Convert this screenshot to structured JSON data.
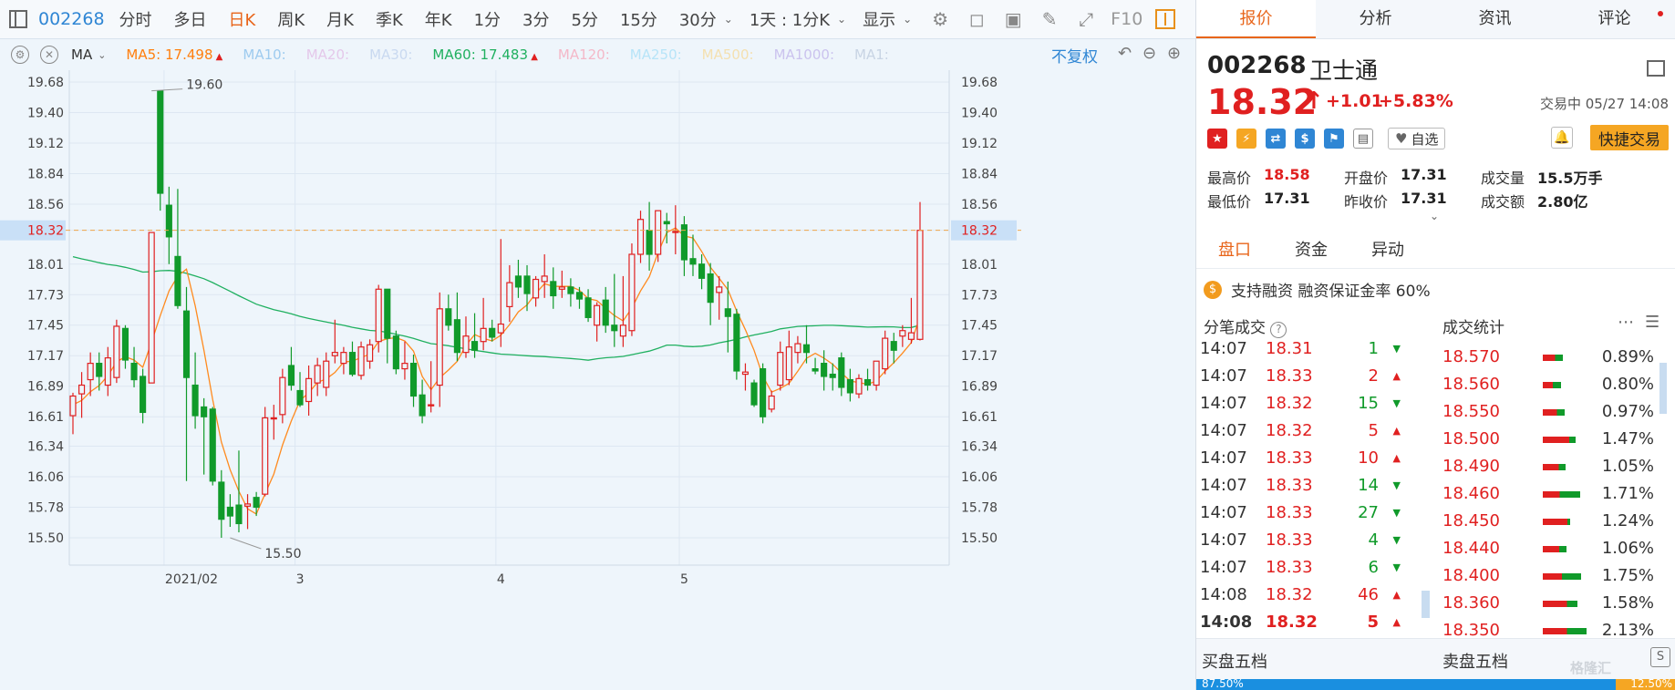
{
  "toolbar": {
    "code": "002268",
    "periods": [
      "分时",
      "多日",
      "日K",
      "周K",
      "月K",
      "季K",
      "年K",
      "1分",
      "3分",
      "5分",
      "15分",
      "30分"
    ],
    "active_period": "日K",
    "range": "1天 : 1分K",
    "display": "显示",
    "f10": "F10"
  },
  "ma_bar": {
    "indicator": "MA",
    "items": [
      {
        "label": "MA5:",
        "value": "17.498",
        "color": "#ff7f0e",
        "up": true
      },
      {
        "label": "MA10:",
        "value": "",
        "color": "#9ecbef",
        "up": false
      },
      {
        "label": "MA20:",
        "value": "",
        "color": "#e4c8ea",
        "up": false
      },
      {
        "label": "MA30:",
        "value": "",
        "color": "#c9d9f0",
        "up": false
      },
      {
        "label": "MA60:",
        "value": "17.483",
        "color": "#20b060",
        "up": true
      },
      {
        "label": "MA120:",
        "value": "",
        "color": "#f4b8c8",
        "up": false
      },
      {
        "label": "MA250:",
        "value": "",
        "color": "#b7e4f8",
        "up": false
      },
      {
        "label": "MA500:",
        "value": "",
        "color": "#f4e0b0",
        "up": false
      },
      {
        "label": "MA1000:",
        "value": "",
        "color": "#cbc3ee",
        "up": false
      },
      {
        "label": "MA1:",
        "value": "",
        "color": "#c8d4e4",
        "up": false
      }
    ],
    "fuquan": "不复权"
  },
  "chart_data": {
    "type": "candlestick",
    "y_ticks": [
      19.68,
      19.4,
      19.12,
      18.84,
      18.56,
      18.32,
      18.01,
      17.73,
      17.45,
      17.17,
      16.89,
      16.61,
      16.34,
      16.06,
      15.78,
      15.5
    ],
    "ylim": [
      15.5,
      19.68
    ],
    "current_price": 18.32,
    "x_labels": [
      {
        "label": "2021/02",
        "index": 12
      },
      {
        "label": "3",
        "index": 27
      },
      {
        "label": "4",
        "index": 50
      },
      {
        "label": "5",
        "index": 71
      }
    ],
    "annotations": [
      {
        "label": "19.60",
        "index": 9,
        "value": 19.6
      },
      {
        "label": "15.50",
        "index": 18,
        "value": 15.5
      }
    ],
    "marker_indices": [
      4,
      10,
      17,
      23,
      24,
      52,
      53,
      57,
      63,
      72
    ],
    "candles": [
      {
        "o": 16.62,
        "h": 16.83,
        "l": 16.45,
        "c": 16.8
      },
      {
        "o": 16.82,
        "h": 17.02,
        "l": 16.6,
        "c": 16.9
      },
      {
        "o": 16.95,
        "h": 17.2,
        "l": 16.8,
        "c": 17.1
      },
      {
        "o": 17.1,
        "h": 17.2,
        "l": 16.85,
        "c": 16.98
      },
      {
        "o": 16.9,
        "h": 17.25,
        "l": 16.8,
        "c": 17.15
      },
      {
        "o": 16.97,
        "h": 17.5,
        "l": 16.92,
        "c": 17.44
      },
      {
        "o": 17.42,
        "h": 17.45,
        "l": 17.05,
        "c": 17.13
      },
      {
        "o": 17.1,
        "h": 17.25,
        "l": 16.88,
        "c": 16.95
      },
      {
        "o": 16.98,
        "h": 17.05,
        "l": 16.55,
        "c": 16.65
      },
      {
        "o": 16.92,
        "h": 18.3,
        "l": 16.92,
        "c": 18.3
      },
      {
        "o": 19.6,
        "h": 19.6,
        "l": 18.5,
        "c": 18.66
      },
      {
        "o": 18.55,
        "h": 18.72,
        "l": 18.01,
        "c": 18.26
      },
      {
        "o": 18.08,
        "h": 18.7,
        "l": 17.6,
        "c": 17.63
      },
      {
        "o": 17.58,
        "h": 17.8,
        "l": 16.02,
        "c": 16.97
      },
      {
        "o": 16.9,
        "h": 17.2,
        "l": 16.5,
        "c": 16.62
      },
      {
        "o": 16.7,
        "h": 16.78,
        "l": 16.08,
        "c": 16.61
      },
      {
        "o": 16.68,
        "h": 16.7,
        "l": 15.98,
        "c": 16.02
      },
      {
        "o": 16.01,
        "h": 16.12,
        "l": 15.5,
        "c": 15.67
      },
      {
        "o": 15.78,
        "h": 15.9,
        "l": 15.6,
        "c": 15.7
      },
      {
        "o": 15.8,
        "h": 16.3,
        "l": 15.55,
        "c": 15.63
      },
      {
        "o": 15.79,
        "h": 15.9,
        "l": 15.58,
        "c": 15.81
      },
      {
        "o": 15.87,
        "h": 15.92,
        "l": 15.7,
        "c": 15.78
      },
      {
        "o": 15.9,
        "h": 16.7,
        "l": 15.88,
        "c": 16.6
      },
      {
        "o": 16.6,
        "h": 16.72,
        "l": 16.4,
        "c": 16.6
      },
      {
        "o": 16.63,
        "h": 17.05,
        "l": 16.55,
        "c": 16.97
      },
      {
        "o": 17.08,
        "h": 17.25,
        "l": 16.85,
        "c": 16.9
      },
      {
        "o": 16.85,
        "h": 17.02,
        "l": 16.7,
        "c": 16.72
      },
      {
        "o": 16.75,
        "h": 17.08,
        "l": 16.62,
        "c": 16.96
      },
      {
        "o": 16.92,
        "h": 17.15,
        "l": 16.8,
        "c": 17.08
      },
      {
        "o": 16.88,
        "h": 17.2,
        "l": 16.8,
        "c": 17.12
      },
      {
        "o": 17.17,
        "h": 17.5,
        "l": 17.1,
        "c": 17.2
      },
      {
        "o": 17.1,
        "h": 17.25,
        "l": 17.0,
        "c": 17.2
      },
      {
        "o": 17.2,
        "h": 17.3,
        "l": 16.98,
        "c": 17.0
      },
      {
        "o": 16.99,
        "h": 17.3,
        "l": 16.95,
        "c": 17.25
      },
      {
        "o": 17.12,
        "h": 17.32,
        "l": 17.05,
        "c": 17.27
      },
      {
        "o": 17.3,
        "h": 17.82,
        "l": 17.2,
        "c": 17.78
      },
      {
        "o": 17.78,
        "h": 17.78,
        "l": 17.1,
        "c": 17.33
      },
      {
        "o": 17.35,
        "h": 17.4,
        "l": 17.0,
        "c": 17.05
      },
      {
        "o": 17.05,
        "h": 17.3,
        "l": 16.95,
        "c": 17.1
      },
      {
        "o": 17.1,
        "h": 17.18,
        "l": 16.7,
        "c": 16.8
      },
      {
        "o": 16.81,
        "h": 16.95,
        "l": 16.55,
        "c": 16.62
      },
      {
        "o": 16.72,
        "h": 17.12,
        "l": 16.65,
        "c": 16.72
      },
      {
        "o": 16.9,
        "h": 17.75,
        "l": 16.7,
        "c": 17.6
      },
      {
        "o": 17.6,
        "h": 17.73,
        "l": 17.4,
        "c": 17.45
      },
      {
        "o": 17.5,
        "h": 17.75,
        "l": 17.12,
        "c": 17.2
      },
      {
        "o": 17.2,
        "h": 17.53,
        "l": 17.15,
        "c": 17.35
      },
      {
        "o": 17.3,
        "h": 17.56,
        "l": 17.15,
        "c": 17.22
      },
      {
        "o": 17.3,
        "h": 17.7,
        "l": 17.22,
        "c": 17.42
      },
      {
        "o": 17.42,
        "h": 17.5,
        "l": 17.3,
        "c": 17.34
      },
      {
        "o": 17.38,
        "h": 18.24,
        "l": 17.25,
        "c": 17.46
      },
      {
        "o": 17.62,
        "h": 18.0,
        "l": 17.48,
        "c": 17.84
      },
      {
        "o": 17.9,
        "h": 18.05,
        "l": 17.7,
        "c": 17.8
      },
      {
        "o": 17.9,
        "h": 18.0,
        "l": 17.58,
        "c": 17.74
      },
      {
        "o": 17.7,
        "h": 17.9,
        "l": 17.62,
        "c": 17.87
      },
      {
        "o": 17.85,
        "h": 18.1,
        "l": 17.7,
        "c": 17.9
      },
      {
        "o": 17.85,
        "h": 17.98,
        "l": 17.6,
        "c": 17.72
      },
      {
        "o": 17.78,
        "h": 17.95,
        "l": 17.7,
        "c": 17.8
      },
      {
        "o": 17.8,
        "h": 17.88,
        "l": 17.62,
        "c": 17.74
      },
      {
        "o": 17.75,
        "h": 17.8,
        "l": 17.6,
        "c": 17.69
      },
      {
        "o": 17.7,
        "h": 17.78,
        "l": 17.48,
        "c": 17.52
      },
      {
        "o": 17.45,
        "h": 17.66,
        "l": 17.3,
        "c": 17.63
      },
      {
        "o": 17.68,
        "h": 17.8,
        "l": 17.38,
        "c": 17.45
      },
      {
        "o": 17.45,
        "h": 17.92,
        "l": 17.25,
        "c": 17.4
      },
      {
        "o": 17.35,
        "h": 17.9,
        "l": 17.25,
        "c": 17.45
      },
      {
        "o": 17.4,
        "h": 18.2,
        "l": 17.35,
        "c": 18.1
      },
      {
        "o": 18.1,
        "h": 18.5,
        "l": 18.02,
        "c": 18.42
      },
      {
        "o": 18.32,
        "h": 18.58,
        "l": 17.95,
        "c": 18.1
      },
      {
        "o": 18.1,
        "h": 18.5,
        "l": 18.03,
        "c": 18.5
      },
      {
        "o": 18.4,
        "h": 18.48,
        "l": 18.2,
        "c": 18.38
      },
      {
        "o": 18.3,
        "h": 18.55,
        "l": 18.1,
        "c": 18.31
      },
      {
        "o": 18.37,
        "h": 18.45,
        "l": 17.9,
        "c": 18.05
      },
      {
        "o": 18.06,
        "h": 18.28,
        "l": 17.9,
        "c": 18.01
      },
      {
        "o": 18.01,
        "h": 18.1,
        "l": 17.78,
        "c": 17.88
      },
      {
        "o": 17.92,
        "h": 18.02,
        "l": 17.45,
        "c": 17.66
      },
      {
        "o": 17.75,
        "h": 17.9,
        "l": 17.5,
        "c": 17.8
      },
      {
        "o": 17.6,
        "h": 17.85,
        "l": 17.2,
        "c": 17.53
      },
      {
        "o": 17.55,
        "h": 17.6,
        "l": 16.95,
        "c": 17.03
      },
      {
        "o": 17.0,
        "h": 17.1,
        "l": 16.85,
        "c": 17.02
      },
      {
        "o": 16.92,
        "h": 16.95,
        "l": 16.7,
        "c": 16.72
      },
      {
        "o": 17.05,
        "h": 17.1,
        "l": 16.55,
        "c": 16.61
      },
      {
        "o": 16.68,
        "h": 16.85,
        "l": 16.65,
        "c": 16.8
      },
      {
        "o": 16.9,
        "h": 17.3,
        "l": 16.85,
        "c": 17.2
      },
      {
        "o": 16.95,
        "h": 17.4,
        "l": 16.9,
        "c": 17.25
      },
      {
        "o": 17.2,
        "h": 17.35,
        "l": 17.1,
        "c": 17.28
      },
      {
        "o": 17.27,
        "h": 17.45,
        "l": 17.1,
        "c": 17.2
      },
      {
        "o": 17.05,
        "h": 17.15,
        "l": 17.0,
        "c": 17.03
      },
      {
        "o": 17.1,
        "h": 17.22,
        "l": 16.85,
        "c": 16.98
      },
      {
        "o": 17.0,
        "h": 17.1,
        "l": 16.85,
        "c": 16.97
      },
      {
        "o": 17.15,
        "h": 17.2,
        "l": 16.8,
        "c": 16.88
      },
      {
        "o": 16.95,
        "h": 17.05,
        "l": 16.75,
        "c": 16.83
      },
      {
        "o": 16.82,
        "h": 17.0,
        "l": 16.78,
        "c": 16.96
      },
      {
        "o": 16.95,
        "h": 17.05,
        "l": 16.85,
        "c": 16.9
      },
      {
        "o": 16.9,
        "h": 17.1,
        "l": 16.85,
        "c": 17.12
      },
      {
        "o": 17.05,
        "h": 17.4,
        "l": 17.0,
        "c": 17.33
      },
      {
        "o": 17.3,
        "h": 17.38,
        "l": 17.1,
        "c": 17.22
      },
      {
        "o": 17.35,
        "h": 17.45,
        "l": 17.25,
        "c": 17.4
      },
      {
        "o": 17.32,
        "h": 17.7,
        "l": 17.28,
        "c": 17.38
      },
      {
        "o": 17.32,
        "h": 18.58,
        "l": 17.31,
        "c": 18.32
      }
    ]
  },
  "quote": {
    "code": "002268",
    "name": "卫士通",
    "price": "18.32",
    "change": "+1.01",
    "change_pct": "+5.83%",
    "status": "交易中 05/27 14:08",
    "watch": "自选",
    "fast_trade": "快捷交易",
    "fields": [
      {
        "label": "最高价",
        "value": "18.58",
        "cls": "red"
      },
      {
        "label": "开盘价",
        "value": "17.31",
        "cls": "dk"
      },
      {
        "label": "成交量",
        "value": "15.5万手",
        "cls": "dk"
      },
      {
        "label": "最低价",
        "value": "17.31",
        "cls": "dk"
      },
      {
        "label": "昨收价",
        "value": "17.31",
        "cls": "dk"
      },
      {
        "label": "成交额",
        "value": "2.80亿",
        "cls": "dk"
      }
    ]
  },
  "tabs": [
    "报价",
    "分析",
    "资讯",
    "评论"
  ],
  "subtabs": [
    "盘口",
    "资金",
    "异动"
  ],
  "margin_text": "支持融资 融资保证金率 60%",
  "ticks_title": "分笔成交",
  "stats_title": "成交统计",
  "ticks": [
    {
      "time": "14:07",
      "price": "18.31",
      "vol": "1",
      "dir": "down"
    },
    {
      "time": "14:07",
      "price": "18.33",
      "vol": "2",
      "dir": "up"
    },
    {
      "time": "14:07",
      "price": "18.32",
      "vol": "15",
      "dir": "down"
    },
    {
      "time": "14:07",
      "price": "18.32",
      "vol": "5",
      "dir": "up"
    },
    {
      "time": "14:07",
      "price": "18.33",
      "vol": "10",
      "dir": "up"
    },
    {
      "time": "14:07",
      "price": "18.33",
      "vol": "14",
      "dir": "down"
    },
    {
      "time": "14:07",
      "price": "18.33",
      "vol": "27",
      "dir": "down"
    },
    {
      "time": "14:07",
      "price": "18.33",
      "vol": "4",
      "dir": "down"
    },
    {
      "time": "14:07",
      "price": "18.33",
      "vol": "6",
      "dir": "down"
    },
    {
      "time": "14:08",
      "price": "18.32",
      "vol": "46",
      "dir": "up"
    },
    {
      "time": "14:08",
      "price": "18.32",
      "vol": "5",
      "dir": "up"
    }
  ],
  "stats": [
    {
      "price": "18.570",
      "pct": "0.89%",
      "r": 0.62,
      "g": 0.38,
      "len": 0.45
    },
    {
      "price": "18.560",
      "pct": "0.80%",
      "r": 0.55,
      "g": 0.45,
      "len": 0.42
    },
    {
      "price": "18.550",
      "pct": "0.97%",
      "r": 0.65,
      "g": 0.35,
      "len": 0.5
    },
    {
      "price": "18.500",
      "pct": "1.47%",
      "r": 0.8,
      "g": 0.2,
      "len": 0.75
    },
    {
      "price": "18.490",
      "pct": "1.05%",
      "r": 0.7,
      "g": 0.3,
      "len": 0.53
    },
    {
      "price": "18.460",
      "pct": "1.71%",
      "r": 0.45,
      "g": 0.55,
      "len": 0.86
    },
    {
      "price": "18.450",
      "pct": "1.24%",
      "r": 0.9,
      "g": 0.1,
      "len": 0.63
    },
    {
      "price": "18.440",
      "pct": "1.06%",
      "r": 0.7,
      "g": 0.3,
      "len": 0.54
    },
    {
      "price": "18.400",
      "pct": "1.75%",
      "r": 0.5,
      "g": 0.5,
      "len": 0.88
    },
    {
      "price": "18.360",
      "pct": "1.58%",
      "r": 0.7,
      "g": 0.3,
      "len": 0.8
    },
    {
      "price": "18.350",
      "pct": "2.13%",
      "r": 0.55,
      "g": 0.45,
      "len": 1.0
    }
  ],
  "bid_title": "买盘五档",
  "ask_title": "卖盘五档",
  "ratio": {
    "bid": "87.50%",
    "ask": "12.50%"
  },
  "watermark": "格隆汇"
}
